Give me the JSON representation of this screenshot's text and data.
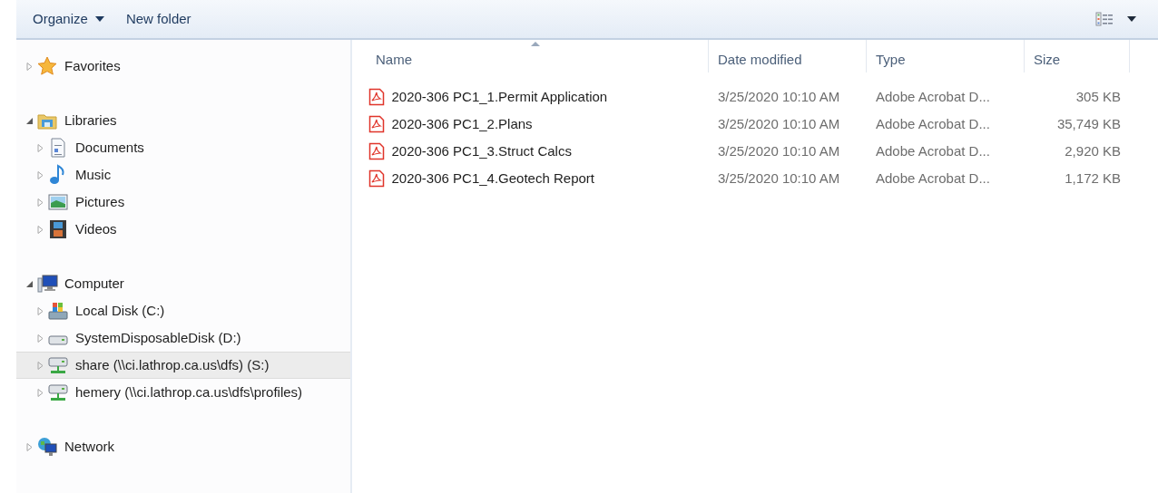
{
  "toolbar": {
    "buttons": [
      {
        "label": "Organize",
        "dropdown": true
      },
      {
        "label": "New folder",
        "dropdown": false
      }
    ]
  },
  "navigation": {
    "groups": [
      {
        "label": "Favorites",
        "kind": "favorites",
        "expanded": false,
        "selected": false
      },
      {
        "label": "Libraries",
        "kind": "libraries",
        "expanded": true,
        "selected": false,
        "children": [
          {
            "label": "Documents",
            "kind": "documents",
            "expanded": false,
            "selected": false
          },
          {
            "label": "Music",
            "kind": "music",
            "expanded": false,
            "selected": false
          },
          {
            "label": "Pictures",
            "kind": "pictures",
            "expanded": false,
            "selected": false
          },
          {
            "label": "Videos",
            "kind": "videos",
            "expanded": false,
            "selected": false
          }
        ]
      },
      {
        "label": "Computer",
        "kind": "computer",
        "expanded": true,
        "selected": false,
        "children": [
          {
            "label": "Local Disk (C:)",
            "kind": "system-disk",
            "expanded": false,
            "selected": false
          },
          {
            "label": "SystemDisposableDisk (D:)",
            "kind": "disk",
            "expanded": false,
            "selected": false
          },
          {
            "label": "share (\\\\ci.lathrop.ca.us\\dfs) (S:)",
            "kind": "network-drive",
            "expanded": false,
            "selected": true
          },
          {
            "label": "hemery (\\\\ci.lathrop.ca.us\\dfs\\profiles)",
            "kind": "network-drive",
            "expanded": false,
            "selected": false
          }
        ]
      },
      {
        "label": "Network",
        "kind": "network",
        "expanded": false,
        "selected": false
      }
    ]
  },
  "files": {
    "columns": [
      {
        "label": "Name",
        "sorted": true
      },
      {
        "label": "Date modified",
        "sorted": false
      },
      {
        "label": "Type",
        "sorted": false
      },
      {
        "label": "Size",
        "sorted": false
      }
    ],
    "rows": [
      {
        "name": "2020-306 PC1_1.Permit Application",
        "date": "3/25/2020 10:10 AM",
        "type": "Adobe Acrobat D...",
        "size": "305 KB"
      },
      {
        "name": "2020-306 PC1_2.Plans",
        "date": "3/25/2020 10:10 AM",
        "type": "Adobe Acrobat D...",
        "size": "35,749 KB"
      },
      {
        "name": "2020-306 PC1_3.Struct Calcs",
        "date": "3/25/2020 10:10 AM",
        "type": "Adobe Acrobat D...",
        "size": "2,920 KB"
      },
      {
        "name": "2020-306 PC1_4.Geotech Report",
        "date": "3/25/2020 10:10 AM",
        "type": "Adobe Acrobat D...",
        "size": "1,172 KB"
      }
    ]
  }
}
